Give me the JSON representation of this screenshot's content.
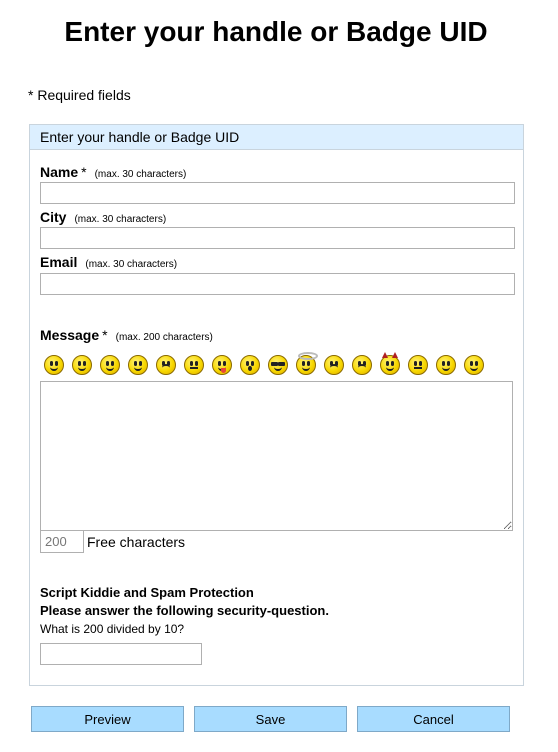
{
  "page": {
    "title": "Enter your handle or Badge UID",
    "required_note": "* Required fields"
  },
  "form": {
    "header": "Enter your handle or Badge UID",
    "name": {
      "label": "Name",
      "required_mark": "*",
      "hint": "(max. 30 characters)",
      "value": ""
    },
    "city": {
      "label": "City",
      "hint": "(max. 30 characters)",
      "value": ""
    },
    "email": {
      "label": "Email",
      "hint": "(max. 30 characters)",
      "value": ""
    },
    "message": {
      "label": "Message",
      "required_mark": "*",
      "hint": "(max. 200 characters)",
      "value": "",
      "free_count": "200",
      "free_label": "Free characters"
    },
    "emojis": [
      "smile-icon",
      "grin-icon",
      "happy-icon",
      "laugh-icon",
      "sad-icon",
      "confused-icon",
      "tongue-icon",
      "surprised-icon",
      "cool-icon",
      "angel-icon",
      "angry-icon",
      "worried-icon",
      "devil-icon",
      "neutral-icon",
      "blush-icon",
      "wink-icon"
    ],
    "captcha": {
      "title": "Script Kiddie and Spam Protection",
      "instruction": "Please answer the following security-question.",
      "question": "What is 200 divided by 10?",
      "value": ""
    }
  },
  "buttons": {
    "preview": "Preview",
    "save": "Save",
    "cancel": "Cancel"
  },
  "colors": {
    "header_bg": "#dcefff",
    "button_bg": "#a8dcff",
    "emoji_yellow": "#f8d800"
  }
}
